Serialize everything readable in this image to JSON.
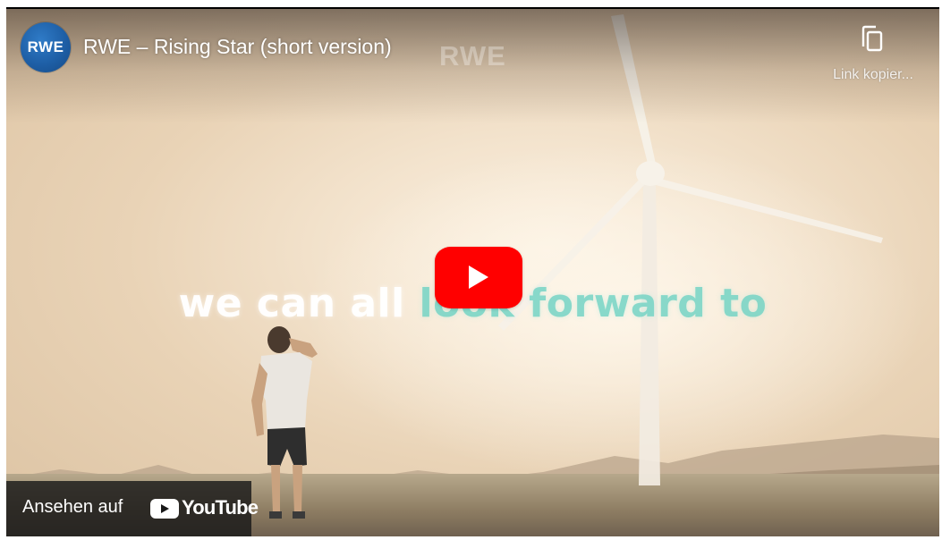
{
  "player": {
    "channel_logo_text": "RWE",
    "title": "RWE – Rising Star (short version)",
    "watermark": "RWE",
    "copy_link_label": "Link kopier...",
    "overlay_text_white": "we can all",
    "overlay_text_teal": "look forward to",
    "watch_on_label": "Ansehen auf",
    "youtube_logo_text": "YouTube"
  },
  "colors": {
    "play_button": "#ff0000",
    "channel_logo": "#1e5fa6",
    "overlay_teal": "#6fd3c4"
  },
  "icons": {
    "copy": "copy-icon",
    "play": "play-icon",
    "youtube": "youtube-logo-icon"
  }
}
